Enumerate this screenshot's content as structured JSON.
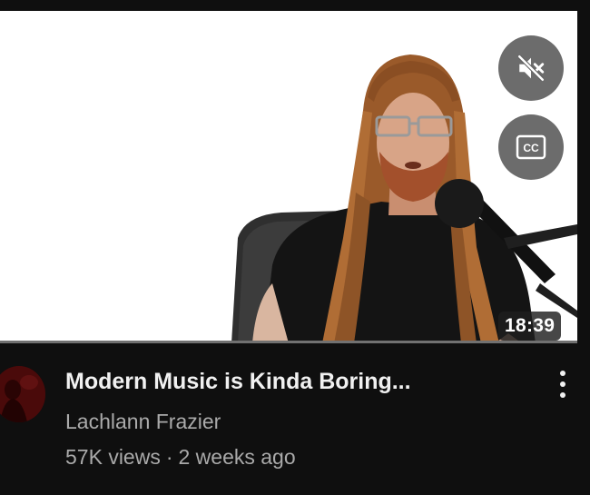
{
  "video": {
    "title": "Modern Music is Kinda Boring...",
    "channel": "Lachlann Frazier",
    "views": "57K views",
    "separator": "·",
    "age": "2 weeks ago",
    "duration": "18:39"
  },
  "controls": {
    "mute_icon": "volume-muted-icon",
    "cc_icon": "closed-captions-icon",
    "cc_text": "CC",
    "more_icon": "more-vert-icon"
  },
  "colors": {
    "background": "#0f0f0f",
    "title": "#f1f1f1",
    "secondary_text": "#aaaaaa",
    "overlay_button": "#606060"
  }
}
